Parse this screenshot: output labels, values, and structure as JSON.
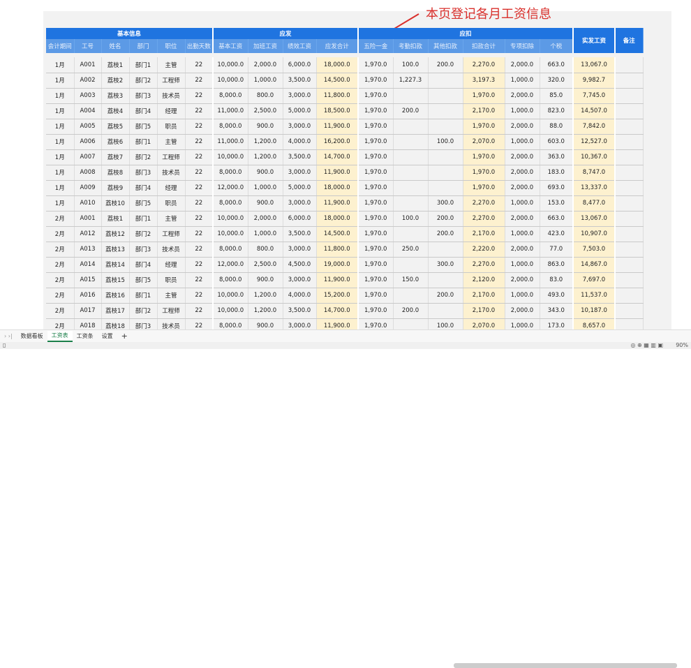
{
  "annotation": {
    "text": "本页登记各月工资信息",
    "color": "#d9302c"
  },
  "header_groups": [
    "基本信息",
    "应发",
    "应扣",
    "实发工资",
    "备注"
  ],
  "columns": [
    "会计期间",
    "工号",
    "姓名",
    "部门",
    "职位",
    "出勤天数",
    "基本工资",
    "加班工资",
    "绩效工资",
    "应发合计",
    "五险一金",
    "考勤扣款",
    "其他扣款",
    "扣款合计",
    "专项扣除",
    "个税"
  ],
  "rows": [
    [
      "1月",
      "A001",
      "荔枝1",
      "部门1",
      "主管",
      "22",
      "10,000.0",
      "2,000.0",
      "6,000.0",
      "18,000.0",
      "1,970.0",
      "100.0",
      "200.0",
      "2,270.0",
      "2,000.0",
      "663.0",
      "13,067.0",
      ""
    ],
    [
      "1月",
      "A002",
      "荔枝2",
      "部门2",
      "工程师",
      "22",
      "10,000.0",
      "1,000.0",
      "3,500.0",
      "14,500.0",
      "1,970.0",
      "1,227.3",
      "",
      "3,197.3",
      "1,000.0",
      "320.0",
      "9,982.7",
      ""
    ],
    [
      "1月",
      "A003",
      "荔枝3",
      "部门3",
      "技术员",
      "22",
      "8,000.0",
      "800.0",
      "3,000.0",
      "11,800.0",
      "1,970.0",
      "",
      "",
      "1,970.0",
      "2,000.0",
      "85.0",
      "7,745.0",
      ""
    ],
    [
      "1月",
      "A004",
      "荔枝4",
      "部门4",
      "经理",
      "22",
      "11,000.0",
      "2,500.0",
      "5,000.0",
      "18,500.0",
      "1,970.0",
      "200.0",
      "",
      "2,170.0",
      "1,000.0",
      "823.0",
      "14,507.0",
      ""
    ],
    [
      "1月",
      "A005",
      "荔枝5",
      "部门5",
      "职员",
      "22",
      "8,000.0",
      "900.0",
      "3,000.0",
      "11,900.0",
      "1,970.0",
      "",
      "",
      "1,970.0",
      "2,000.0",
      "88.0",
      "7,842.0",
      ""
    ],
    [
      "1月",
      "A006",
      "荔枝6",
      "部门1",
      "主管",
      "22",
      "11,000.0",
      "1,200.0",
      "4,000.0",
      "16,200.0",
      "1,970.0",
      "",
      "100.0",
      "2,070.0",
      "1,000.0",
      "603.0",
      "12,527.0",
      ""
    ],
    [
      "1月",
      "A007",
      "荔枝7",
      "部门2",
      "工程师",
      "22",
      "10,000.0",
      "1,200.0",
      "3,500.0",
      "14,700.0",
      "1,970.0",
      "",
      "",
      "1,970.0",
      "2,000.0",
      "363.0",
      "10,367.0",
      ""
    ],
    [
      "1月",
      "A008",
      "荔枝8",
      "部门3",
      "技术员",
      "22",
      "8,000.0",
      "900.0",
      "3,000.0",
      "11,900.0",
      "1,970.0",
      "",
      "",
      "1,970.0",
      "2,000.0",
      "183.0",
      "8,747.0",
      ""
    ],
    [
      "1月",
      "A009",
      "荔枝9",
      "部门4",
      "经理",
      "22",
      "12,000.0",
      "1,000.0",
      "5,000.0",
      "18,000.0",
      "1,970.0",
      "",
      "",
      "1,970.0",
      "2,000.0",
      "693.0",
      "13,337.0",
      ""
    ],
    [
      "1月",
      "A010",
      "荔枝10",
      "部门5",
      "职员",
      "22",
      "8,000.0",
      "900.0",
      "3,000.0",
      "11,900.0",
      "1,970.0",
      "",
      "300.0",
      "2,270.0",
      "1,000.0",
      "153.0",
      "8,477.0",
      ""
    ],
    [
      "2月",
      "A001",
      "荔枝1",
      "部门1",
      "主管",
      "22",
      "10,000.0",
      "2,000.0",
      "6,000.0",
      "18,000.0",
      "1,970.0",
      "100.0",
      "200.0",
      "2,270.0",
      "2,000.0",
      "663.0",
      "13,067.0",
      ""
    ],
    [
      "2月",
      "A012",
      "荔枝12",
      "部门2",
      "工程师",
      "22",
      "10,000.0",
      "1,000.0",
      "3,500.0",
      "14,500.0",
      "1,970.0",
      "",
      "200.0",
      "2,170.0",
      "1,000.0",
      "423.0",
      "10,907.0",
      ""
    ],
    [
      "2月",
      "A013",
      "荔枝13",
      "部门3",
      "技术员",
      "22",
      "8,000.0",
      "800.0",
      "3,000.0",
      "11,800.0",
      "1,970.0",
      "250.0",
      "",
      "2,220.0",
      "2,000.0",
      "77.0",
      "7,503.0",
      ""
    ],
    [
      "2月",
      "A014",
      "荔枝14",
      "部门4",
      "经理",
      "22",
      "12,000.0",
      "2,500.0",
      "4,500.0",
      "19,000.0",
      "1,970.0",
      "",
      "300.0",
      "2,270.0",
      "1,000.0",
      "863.0",
      "14,867.0",
      ""
    ],
    [
      "2月",
      "A015",
      "荔枝15",
      "部门5",
      "职员",
      "22",
      "8,000.0",
      "900.0",
      "3,000.0",
      "11,900.0",
      "1,970.0",
      "150.0",
      "",
      "2,120.0",
      "2,000.0",
      "83.0",
      "7,697.0",
      ""
    ],
    [
      "2月",
      "A016",
      "荔枝16",
      "部门1",
      "主管",
      "22",
      "10,000.0",
      "1,200.0",
      "4,000.0",
      "15,200.0",
      "1,970.0",
      "",
      "200.0",
      "2,170.0",
      "1,000.0",
      "493.0",
      "11,537.0",
      ""
    ],
    [
      "2月",
      "A017",
      "荔枝17",
      "部门2",
      "工程师",
      "22",
      "10,000.0",
      "1,200.0",
      "3,500.0",
      "14,700.0",
      "1,970.0",
      "200.0",
      "",
      "2,170.0",
      "2,000.0",
      "343.0",
      "10,187.0",
      ""
    ],
    [
      "2月",
      "A018",
      "荔枝18",
      "部门3",
      "技术员",
      "22",
      "8,000.0",
      "900.0",
      "3,000.0",
      "11,900.0",
      "1,970.0",
      "",
      "100.0",
      "2,070.0",
      "1,000.0",
      "173.0",
      "8,657.0",
      ""
    ]
  ],
  "sheet_tabs": [
    "数据看板",
    "工资表",
    "工资条",
    "设置"
  ],
  "active_tab": "工资表",
  "add_sheet": "+",
  "zoom_level": "90%",
  "colors": {
    "header": "#1f74e0",
    "subheader": "#5c9ae6",
    "highlight": "#fdf1cf"
  }
}
